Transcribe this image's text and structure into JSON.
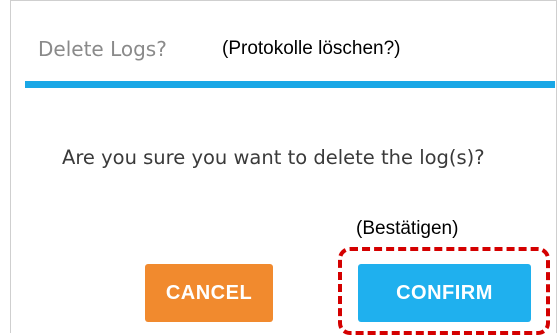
{
  "dialog": {
    "title": "Delete Logs?",
    "title_annotation": "(Protokolle löschen?)",
    "message": "Are you sure you want to delete the log(s)?",
    "confirm_annotation": "(Bestätigen)",
    "buttons": {
      "cancel_label": "CANCEL",
      "confirm_label": "CONFIRM"
    }
  },
  "colors": {
    "accent": "#1aa7e6",
    "cancel": "#f18a2e",
    "confirm": "#1fb0ee",
    "highlight": "#d40000"
  }
}
